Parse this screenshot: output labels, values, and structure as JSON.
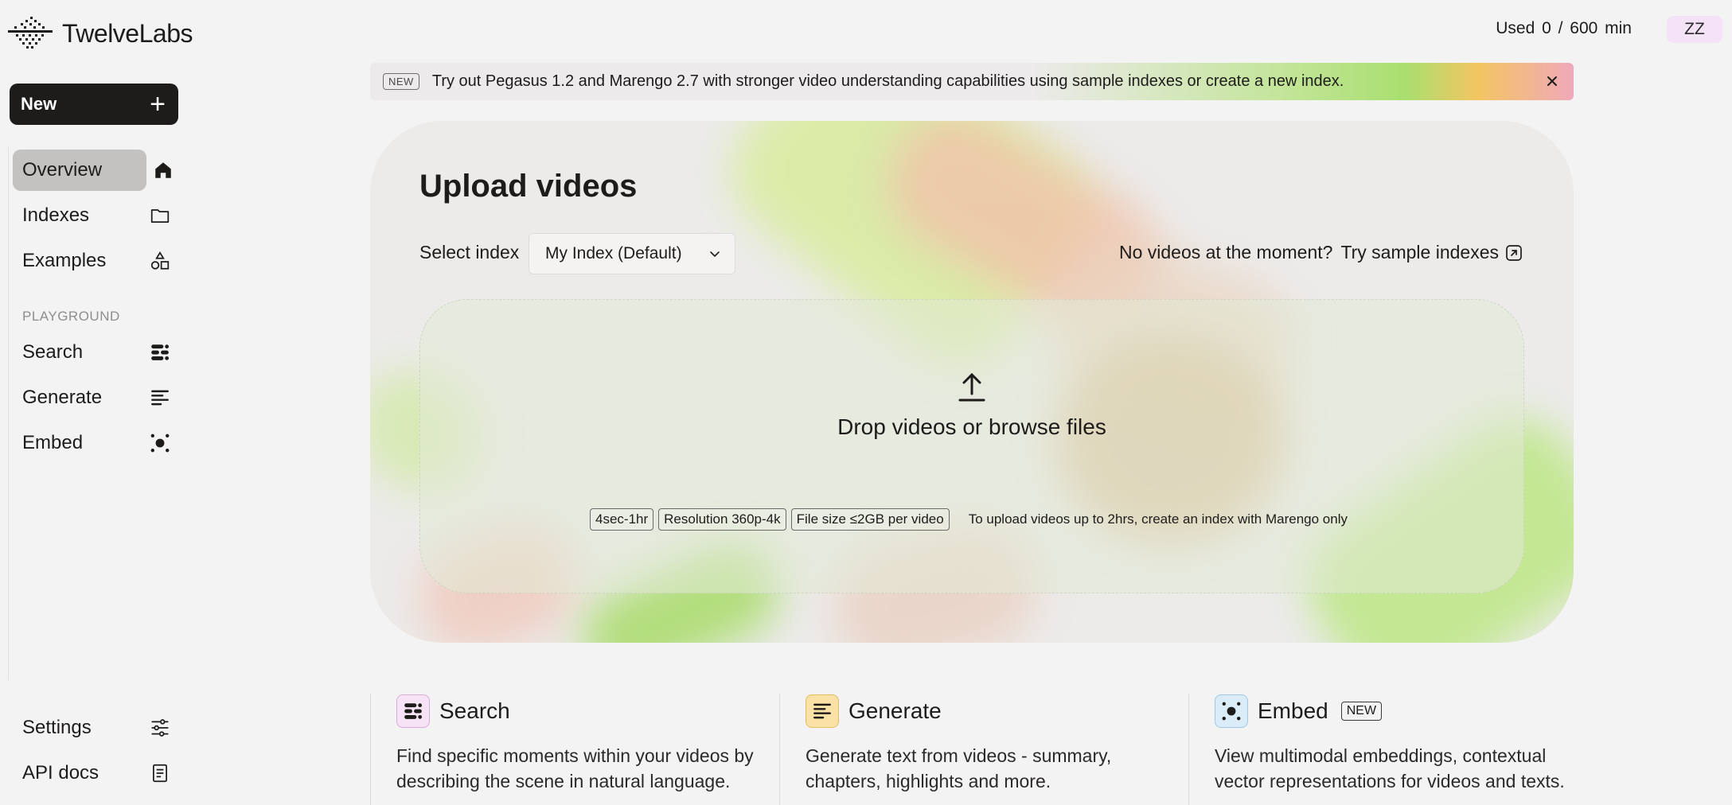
{
  "brand": {
    "name": "TwelveLabs"
  },
  "header": {
    "usage_text": "Used  0  / 600 min",
    "avatar_initials": "ZZ"
  },
  "sidebar": {
    "new_label": "New",
    "nav": [
      {
        "label": "Overview",
        "icon": "home-icon"
      },
      {
        "label": "Indexes",
        "icon": "folder-icon"
      },
      {
        "label": "Examples",
        "icon": "shapes-icon"
      }
    ],
    "playground_label": "PLAYGROUND",
    "playground": [
      {
        "label": "Search",
        "icon": "search-bars-icon"
      },
      {
        "label": "Generate",
        "icon": "generate-lines-icon"
      },
      {
        "label": "Embed",
        "icon": "embed-nodes-icon"
      }
    ],
    "bottom": [
      {
        "label": "Settings",
        "icon": "sliders-icon"
      },
      {
        "label": "API docs",
        "icon": "document-icon"
      }
    ]
  },
  "banner": {
    "tag": "NEW",
    "text": "Try out Pegasus 1.2 and Marengo 2.7 with stronger video understanding capabilities using sample indexes or create a new index."
  },
  "upload": {
    "title": "Upload videos",
    "select_label": "Select index",
    "selected_index": "My Index (Default)",
    "no_videos_text": "No videos at the moment?",
    "sample_link": "Try sample indexes",
    "drop_text": "Drop videos or browse files",
    "chips": [
      "4sec-1hr",
      "Resolution 360p-4k",
      "File size ≤2GB per video"
    ],
    "note": "To upload videos up to 2hrs, create an index with Marengo only"
  },
  "features": [
    {
      "title": "Search",
      "tag": "",
      "desc": "Find specific moments within your videos by describing the scene in natural language.",
      "color": "#f6e3f5"
    },
    {
      "title": "Generate",
      "tag": "",
      "desc": "Generate text from videos - summary, chapters, highlights and more.",
      "color": "#fae1a6"
    },
    {
      "title": "Embed",
      "tag": "NEW",
      "desc": "View multimodal embeddings, contextual vector representations for videos and texts.",
      "color": "#d9ecf7"
    }
  ]
}
